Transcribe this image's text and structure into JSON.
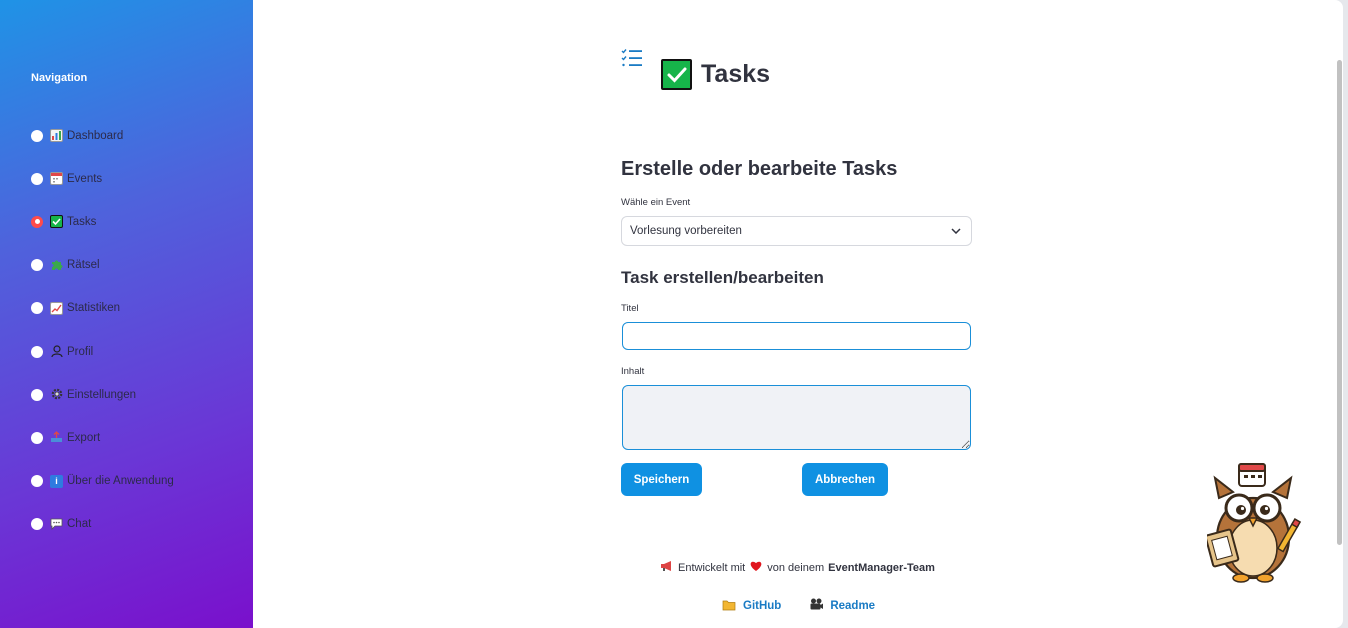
{
  "sidebar": {
    "title": "Navigation",
    "items": [
      {
        "label": "Dashboard",
        "icon": "bar-chart-icon",
        "active": false
      },
      {
        "label": "Events",
        "icon": "calendar-icon",
        "active": false
      },
      {
        "label": "Tasks",
        "icon": "check-box-icon",
        "active": true
      },
      {
        "label": "Rätsel",
        "icon": "puzzle-icon",
        "active": false
      },
      {
        "label": "Statistiken",
        "icon": "trend-chart-icon",
        "active": false
      },
      {
        "label": "Profil",
        "icon": "user-icon",
        "active": false
      },
      {
        "label": "Einstellungen",
        "icon": "gear-icon",
        "active": false
      },
      {
        "label": "Export",
        "icon": "outbox-icon",
        "active": false
      },
      {
        "label": "Über die Anwendung",
        "icon": "info-icon",
        "active": false
      },
      {
        "label": "Chat",
        "icon": "speech-bubble-icon",
        "active": false
      }
    ]
  },
  "header": {
    "title": "Tasks"
  },
  "form": {
    "heading": "Erstelle oder bearbeite Tasks",
    "event_label": "Wähle ein Event",
    "event_value": "Vorlesung vorbereiten",
    "subheading": "Task erstellen/bearbeiten",
    "title_label": "Titel",
    "title_value": "",
    "content_label": "Inhalt",
    "content_value": "",
    "save_label": "Speichern",
    "cancel_label": "Abbrechen"
  },
  "footer": {
    "prefix": "Entwickelt mit",
    "middle": "von deinem",
    "team": "EventManager-Team",
    "github": "GitHub",
    "readme": "Readme"
  },
  "colors": {
    "accent": "#0f91e2",
    "active_radio": "#ff4b4b",
    "sidebar_top": "#1f93e6",
    "sidebar_bottom": "#7a10cc"
  }
}
